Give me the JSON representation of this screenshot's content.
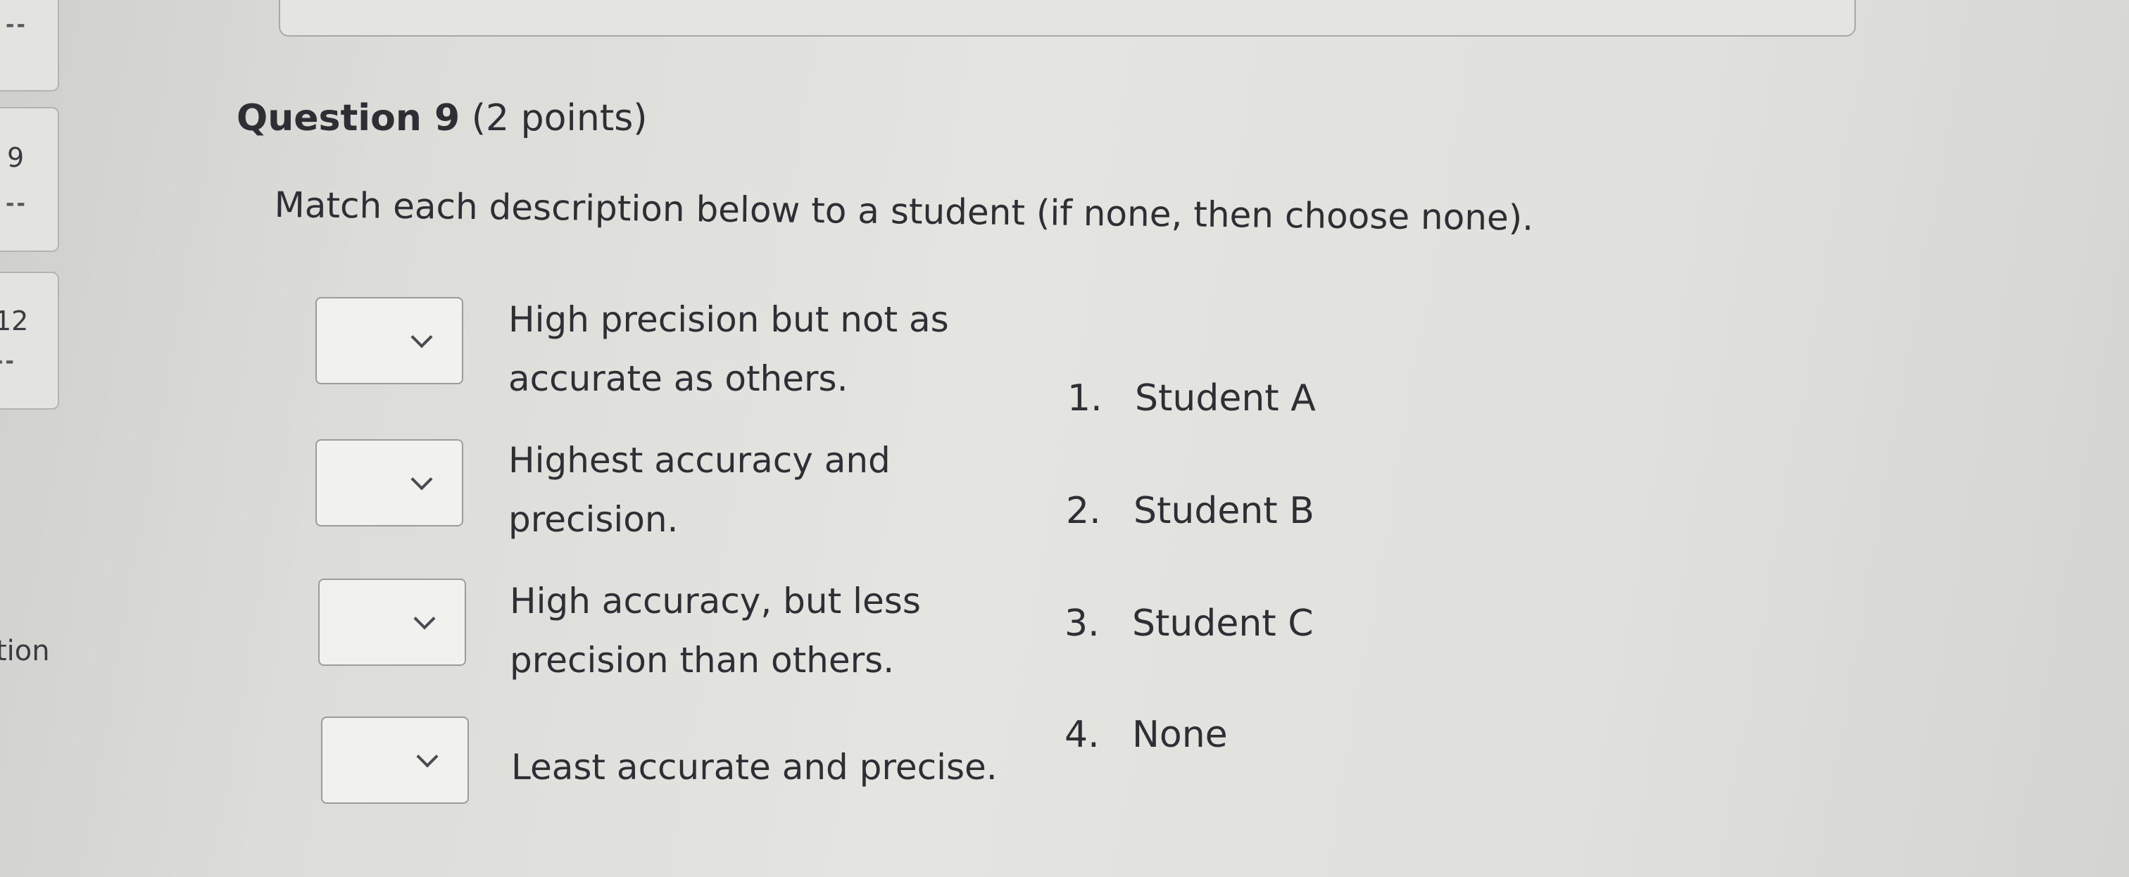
{
  "nav": {
    "items": [
      {
        "number": "",
        "status": "--"
      },
      {
        "number": "9",
        "status": "--"
      },
      {
        "number": "12",
        "status": "--"
      }
    ],
    "partial_label": "tion"
  },
  "question": {
    "title": "Question 9",
    "points": "(2 points)",
    "instructions": "Match each description below to a student (if none, then choose none)."
  },
  "prompts": [
    {
      "line1": "High precision but not as",
      "line2": "accurate as others."
    },
    {
      "line1": "Highest accuracy and",
      "line2": "precision."
    },
    {
      "line1": "High accuracy, but less",
      "line2": "precision than others."
    },
    {
      "line1": "Least accurate and precise.",
      "line2": ""
    }
  ],
  "choices": [
    {
      "number": "1.",
      "label": "Student A"
    },
    {
      "number": "2.",
      "label": "Student B"
    },
    {
      "number": "3.",
      "label": "Student C"
    },
    {
      "number": "4.",
      "label": "None"
    }
  ],
  "dropdowns": [
    {
      "selected": ""
    },
    {
      "selected": ""
    },
    {
      "selected": ""
    },
    {
      "selected": ""
    }
  ]
}
